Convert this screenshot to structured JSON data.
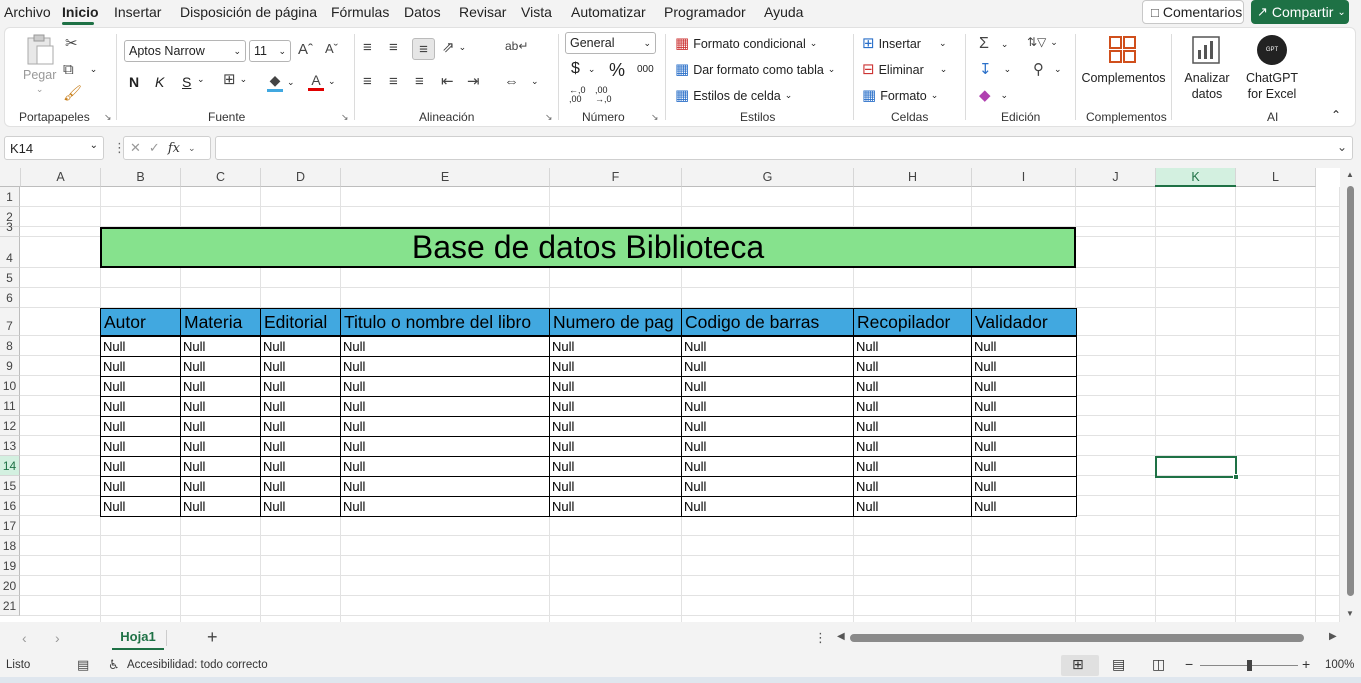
{
  "menu": {
    "tabs": [
      "Archivo",
      "Inicio",
      "Insertar",
      "Disposición de página",
      "Fórmulas",
      "Datos",
      "Revisar",
      "Vista",
      "Automatizar",
      "Programador",
      "Ayuda"
    ],
    "comments_label": "Comentarios",
    "share_label": "Compartir"
  },
  "ribbon": {
    "clipboard": {
      "paste_label": "Pegar",
      "group_label": "Portapapeles"
    },
    "font": {
      "font_name": "Aptos Narrow",
      "font_size": "11",
      "bold": "N",
      "italic": "K",
      "underline": "S",
      "group_label": "Fuente"
    },
    "alignment": {
      "group_label": "Alineación"
    },
    "number": {
      "format": "General",
      "currency": "$",
      "percent": "%",
      "thousands": "000",
      "dec_inc": "←,0 ,00",
      "dec_dec": ",00 →,0",
      "group_label": "Número"
    },
    "styles": {
      "conditional": "Formato condicional",
      "as_table": "Dar formato como tabla",
      "cell_styles": "Estilos de celda",
      "group_label": "Estilos"
    },
    "cells": {
      "insert": "Insertar",
      "delete": "Eliminar",
      "format": "Formato",
      "group_label": "Celdas"
    },
    "editing": {
      "group_label": "Edición"
    },
    "addins": {
      "label": "Complementos",
      "group_label": "Complementos"
    },
    "analyze": {
      "label1": "Analizar",
      "label2": "datos"
    },
    "chatgpt": {
      "label1": "ChatGPT",
      "label2": "for Excel",
      "group_label": "AI"
    }
  },
  "formula_bar": {
    "name_box": "K14",
    "fx": "fx",
    "value": ""
  },
  "columns": [
    "A",
    "B",
    "C",
    "D",
    "E",
    "F",
    "G",
    "H",
    "I",
    "J",
    "K",
    "L"
  ],
  "rows": [
    "1",
    "2",
    "3",
    "4",
    "5",
    "6",
    "7",
    "8",
    "9",
    "10",
    "11",
    "12",
    "13",
    "14",
    "15",
    "16",
    "17",
    "18",
    "19",
    "20",
    "21"
  ],
  "sheet": {
    "title": "Base de datos Biblioteca",
    "headers": [
      "Autor",
      "Materia",
      "Editorial",
      "Titulo o nombre del libro",
      "Numero de pag",
      "Codigo de barras",
      "Recopilador",
      "Validador"
    ],
    "data_rows": [
      [
        "Null",
        "Null",
        "Null",
        "Null",
        "Null",
        "Null",
        "Null",
        "Null"
      ],
      [
        "Null",
        "Null",
        "Null",
        "Null",
        "Null",
        "Null",
        "Null",
        "Null"
      ],
      [
        "Null",
        "Null",
        "Null",
        "Null",
        "Null",
        "Null",
        "Null",
        "Null"
      ],
      [
        "Null",
        "Null",
        "Null",
        "Null",
        "Null",
        "Null",
        "Null",
        "Null"
      ],
      [
        "Null",
        "Null",
        "Null",
        "Null",
        "Null",
        "Null",
        "Null",
        "Null"
      ],
      [
        "Null",
        "Null",
        "Null",
        "Null",
        "Null",
        "Null",
        "Null",
        "Null"
      ],
      [
        "Null",
        "Null",
        "Null",
        "Null",
        "Null",
        "Null",
        "Null",
        "Null"
      ],
      [
        "Null",
        "Null",
        "Null",
        "Null",
        "Null",
        "Null",
        "Null",
        "Null"
      ],
      [
        "Null",
        "Null",
        "Null",
        "Null",
        "Null",
        "Null",
        "Null",
        "Null"
      ]
    ],
    "title_fill": "#86e28d",
    "header_fill": "#41a8e0"
  },
  "sheet_tabs": {
    "active": "Hoja1",
    "add": "+"
  },
  "status": {
    "ready": "Listo",
    "accessibility": "Accesibilidad: todo correcto",
    "zoom": "100%"
  }
}
